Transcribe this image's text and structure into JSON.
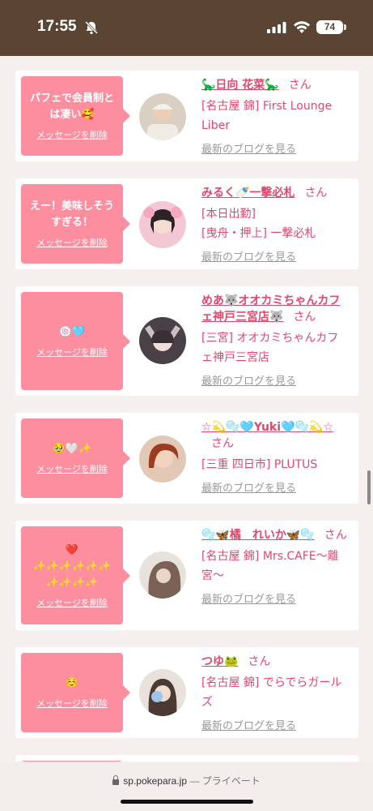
{
  "status": {
    "time": "17:55",
    "battery": "74"
  },
  "cards": [
    {
      "message": "パフェで会員制とは凄い🥰",
      "delete_label": "メッセージを削除",
      "name": "🦕日向 花菜🦕",
      "san": "さん",
      "shop": "[名古屋 錦] First Lounge Liber",
      "blog": "最新のブログを見る"
    },
    {
      "message": "えー！美味しそうすぎる！",
      "delete_label": "メッセージを削除",
      "name": "みるく🍼一撃必札",
      "san": "さん",
      "shop_line1": "[本日出勤]",
      "shop_line2": "[曳舟・押上] 一撃必札",
      "blog": "最新のブログを見る"
    },
    {
      "message": "🍥🩵",
      "delete_label": "メッセージを削除",
      "name": "めあ🐺オオカミちゃんカフェ神戸三宮店🐺",
      "san": "さん",
      "shop": "[三宮] オオカミちゃんカフェ神戸三宮店",
      "blog": "最新のブログを見る"
    },
    {
      "message": "🥹🤍✨",
      "delete_label": "メッセージを削除",
      "name": "☆💫🫧🩵Yuki🩵🫧💫☆",
      "san": "さん",
      "shop": "[三重 四日市] PLUTUS",
      "blog": "最新のブログを見る"
    },
    {
      "message": "❤️\n✨✨✨✨✨✨\n✨✨✨✨",
      "delete_label": "メッセージを削除",
      "name": "🫧🦋橘　れいか🦋🫧",
      "san": "さん",
      "shop": "[名古屋 錦] Mrs.CAFE〜離宮〜",
      "blog": "最新のブログを見る"
    },
    {
      "message": "☺️",
      "delete_label": "メッセージを削除",
      "name": "つゆ🐸",
      "san": "さん",
      "shop": "[名古屋 錦] でらでらガールズ",
      "blog": "最新のブログを見る"
    }
  ],
  "browser": {
    "domain": "sp.pokepara.jp",
    "mode": "— プライベート"
  },
  "colors": {
    "accent": "#e0486e",
    "bubble": "#fd8ea0",
    "header": "#5a4434"
  }
}
